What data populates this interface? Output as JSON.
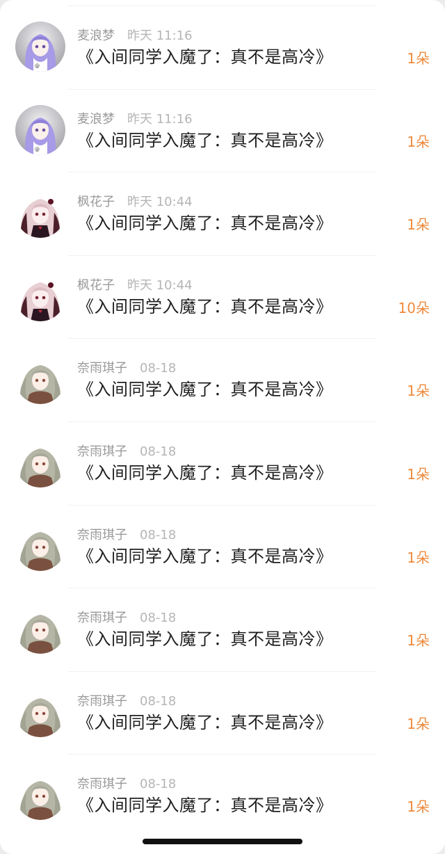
{
  "list": {
    "items": [
      {
        "username": "麦浪梦",
        "time": "昨天 11:16",
        "title": "《入间同学入魔了：真不是高冷》",
        "count": "1朵",
        "avatar": "purple-hair-avatar"
      },
      {
        "username": "麦浪梦",
        "time": "昨天 11:16",
        "title": "《入间同学入魔了：真不是高冷》",
        "count": "1朵",
        "avatar": "purple-hair-avatar"
      },
      {
        "username": "枫花子",
        "time": "昨天 10:44",
        "title": "《入间同学入魔了：真不是高冷》",
        "count": "1朵",
        "avatar": "pink-hair-avatar"
      },
      {
        "username": "枫花子",
        "time": "昨天 10:44",
        "title": "《入间同学入魔了：真不是高冷》",
        "count": "10朵",
        "avatar": "pink-hair-avatar"
      },
      {
        "username": "奈雨琪子",
        "time": "08-18",
        "title": "《入间同学入魔了：真不是高冷》",
        "count": "1朵",
        "avatar": "green-hair-avatar"
      },
      {
        "username": "奈雨琪子",
        "time": "08-18",
        "title": "《入间同学入魔了：真不是高冷》",
        "count": "1朵",
        "avatar": "green-hair-avatar"
      },
      {
        "username": "奈雨琪子",
        "time": "08-18",
        "title": "《入间同学入魔了：真不是高冷》",
        "count": "1朵",
        "avatar": "green-hair-avatar"
      },
      {
        "username": "奈雨琪子",
        "time": "08-18",
        "title": "《入间同学入魔了：真不是高冷》",
        "count": "1朵",
        "avatar": "green-hair-avatar"
      },
      {
        "username": "奈雨琪子",
        "time": "08-18",
        "title": "《入间同学入魔了：真不是高冷》",
        "count": "1朵",
        "avatar": "green-hair-avatar"
      },
      {
        "username": "奈雨琪子",
        "time": "08-18",
        "title": "《入间同学入魔了：真不是高冷》",
        "count": "1朵",
        "avatar": "green-hair-avatar"
      }
    ]
  },
  "colors": {
    "count_accent": "#ef8a3c",
    "title_text": "#1f1f1f",
    "username_text": "#9a9a9a",
    "time_text": "#b5b5b5",
    "separator": "#f1f1f1"
  }
}
